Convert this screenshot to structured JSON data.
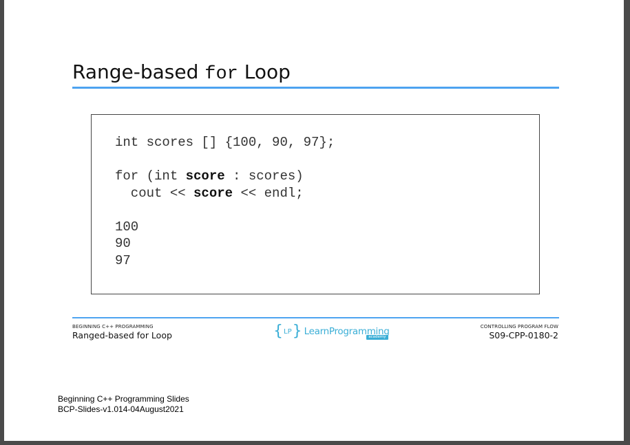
{
  "slide": {
    "title_prefix": "Range-based ",
    "title_code": "for",
    "title_suffix": " Loop",
    "code": {
      "line1": "int scores [] {100, 90, 97};",
      "line2_a": "for (int ",
      "line2_b": "score",
      "line2_c": " : scores)",
      "line3_a": "  cout << ",
      "line3_b": "score",
      "line3_c": " << endl;",
      "output": [
        "100",
        "90",
        "97"
      ]
    },
    "footer": {
      "left_small": "BEGINNING C++ PROGRAMMING",
      "left_main": "Ranged-based for Loop",
      "logo_brace_open": "{",
      "logo_lp": "LP",
      "logo_brace_close": "}",
      "logo_name": "LearnProgramming",
      "logo_sub": "academy",
      "right_small": "CONTROLLING PROGRAM FLOW",
      "right_main": "S09-CPP-0180-2"
    }
  },
  "notes": {
    "line1": "Beginning C++ Programming Slides",
    "line2": "BCP-Slides-v1.014-04August2021"
  },
  "colors": {
    "accent_rule": "#4da3f0",
    "logo": "#3aaed6",
    "background": "#4a4a4a"
  }
}
